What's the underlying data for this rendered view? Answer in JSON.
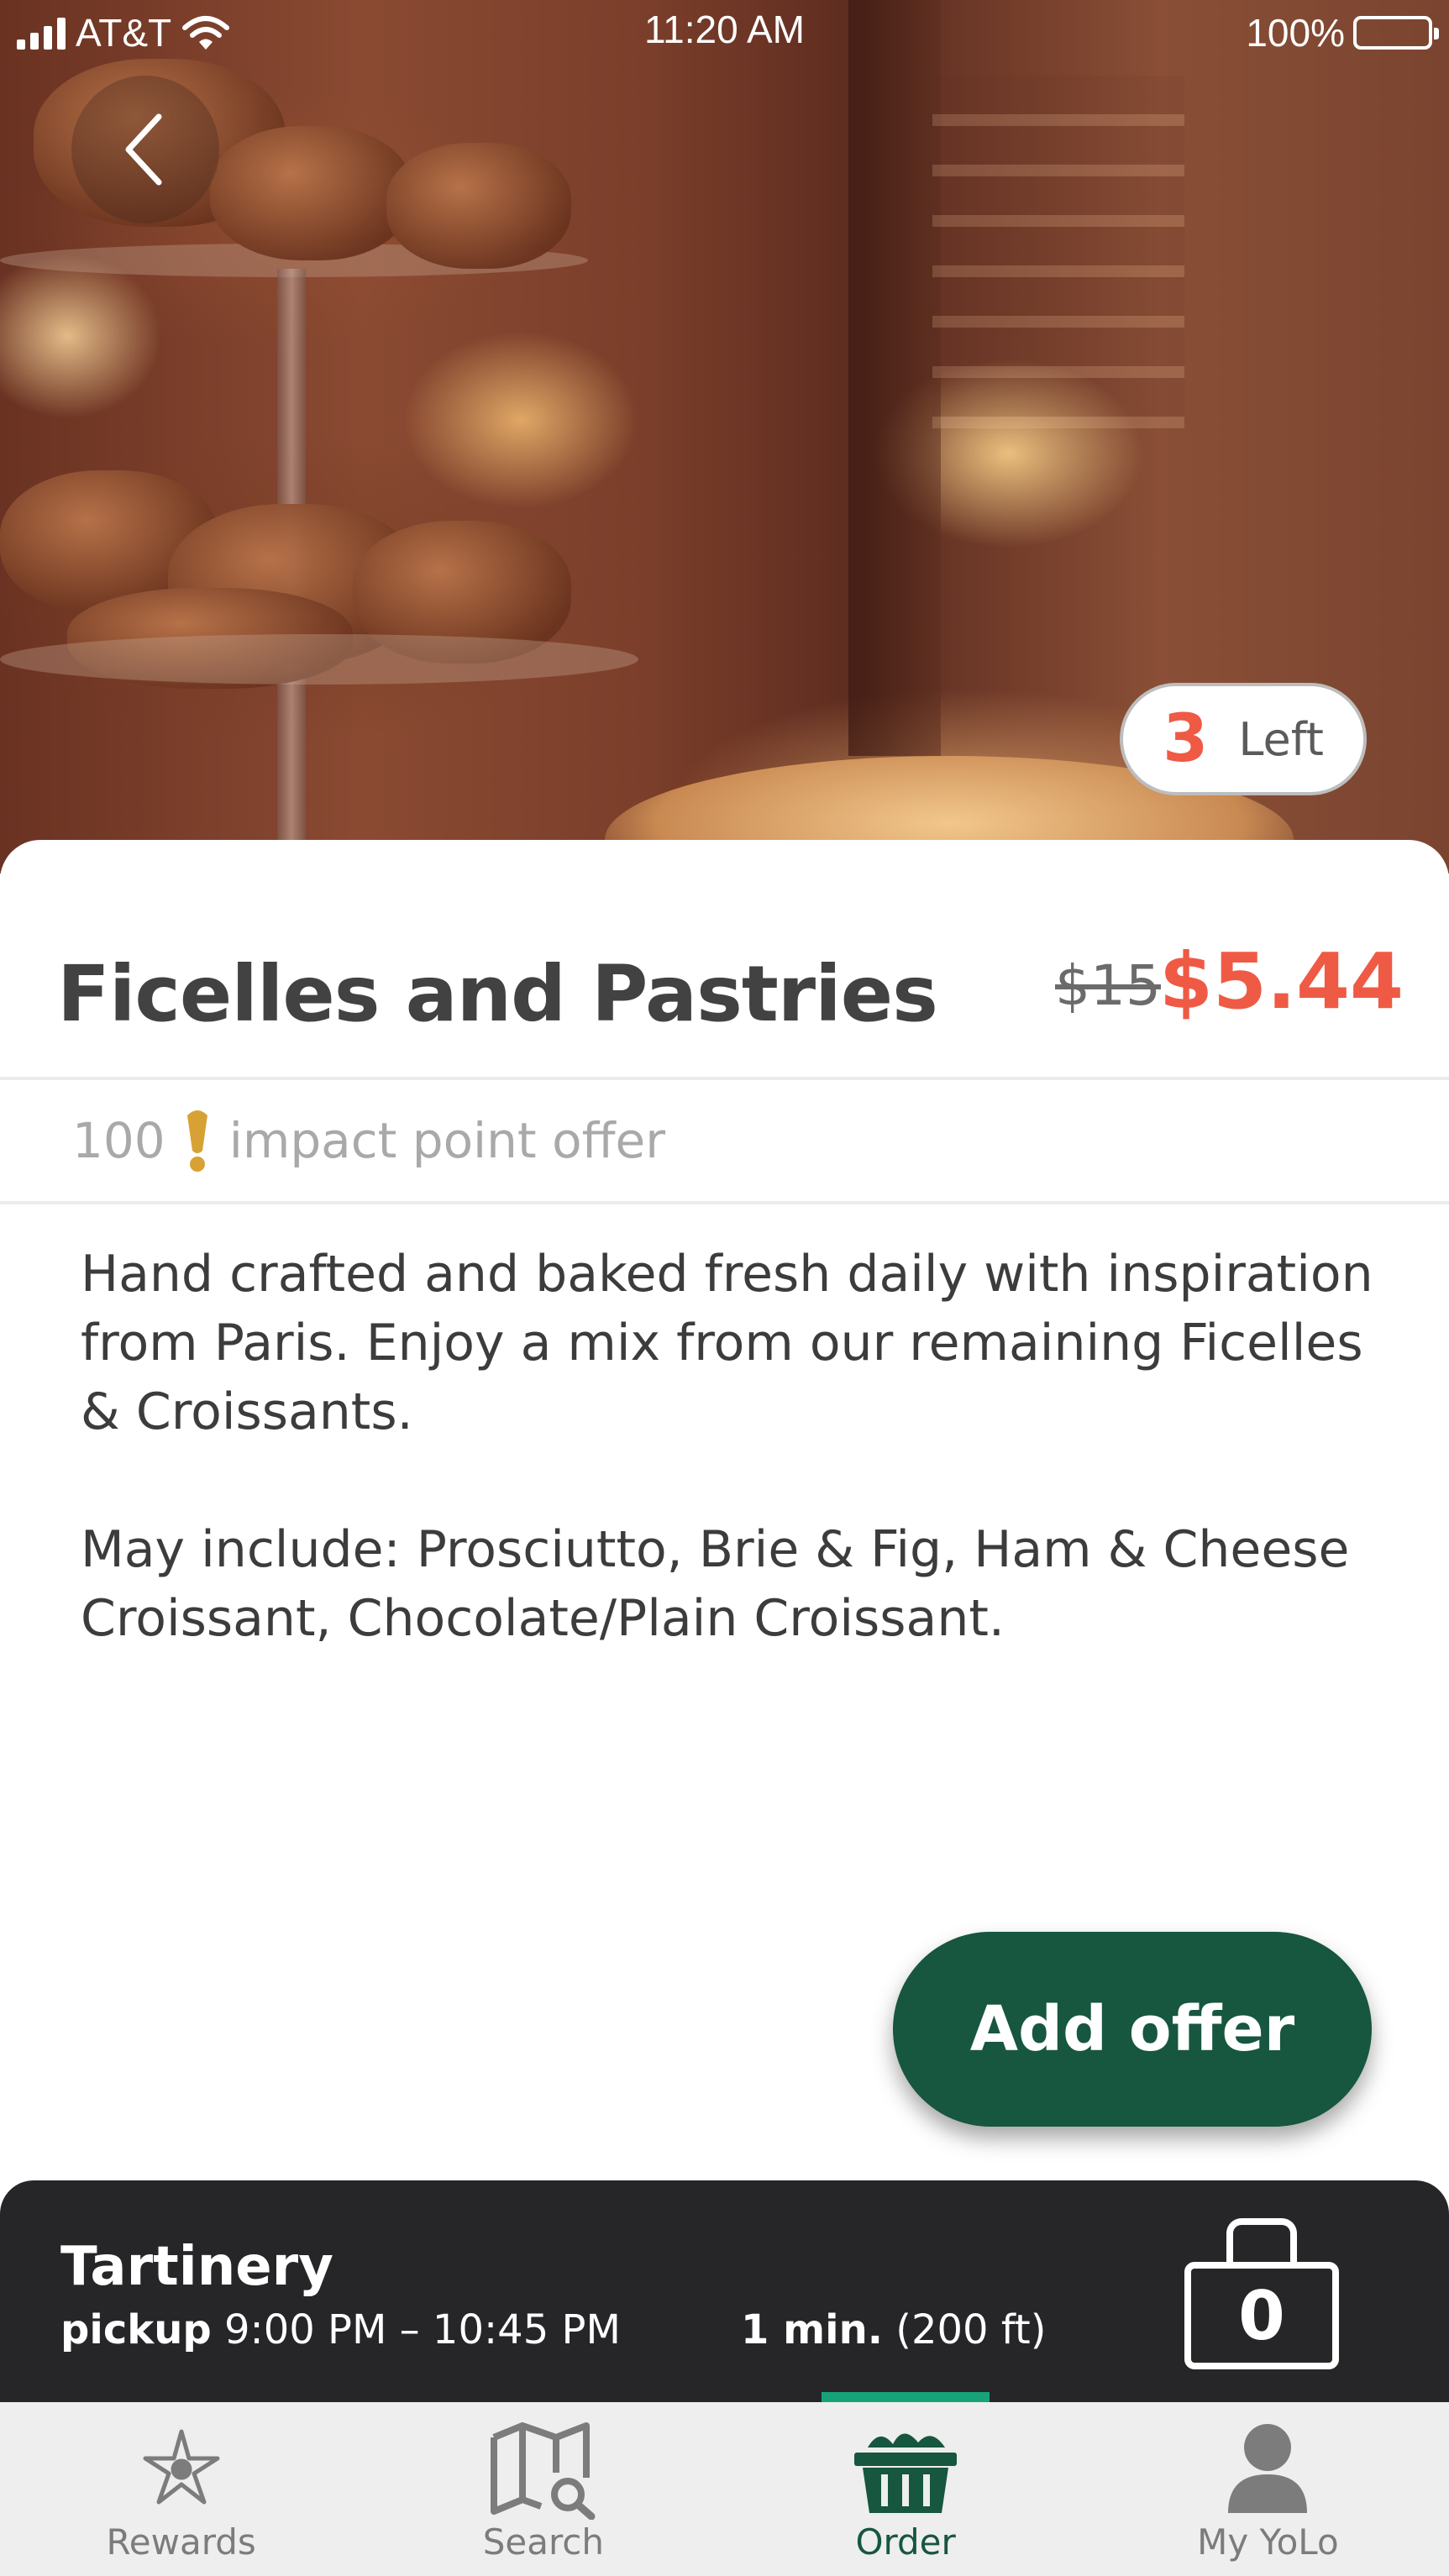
{
  "status_bar": {
    "carrier": "AT&T",
    "time": "11:20 AM",
    "battery": "100%"
  },
  "offer": {
    "remaining_count": "3",
    "remaining_label": "Left",
    "title": "Ficelles and Pastries",
    "original_price": "$15",
    "price": "$5.44",
    "impact_points": "100",
    "impact_label": "impact point offer",
    "description": [
      "Hand crafted and baked fresh daily with inspiration from Paris. Enjoy a mix from our remaining Ficelles & Croissants.",
      "May include: Prosciutto, Brie & Fig, Ham & Cheese Croissant, Chocolate/Plain Croissant."
    ],
    "add_button": "Add offer"
  },
  "pickup": {
    "store": "Tartinery",
    "pickup_label": "pickup",
    "window": "9:00 PM – 10:45 PM",
    "travel_time": "1 min.",
    "distance": "(200 ft)",
    "bag_count": "0"
  },
  "tabs": [
    {
      "label": "Rewards",
      "icon": "rewards-star-icon",
      "active": false
    },
    {
      "label": "Search",
      "icon": "map-search-icon",
      "active": false
    },
    {
      "label": "Order",
      "icon": "basket-icon",
      "active": true
    },
    {
      "label": "My YoLo",
      "icon": "user-icon",
      "active": false
    }
  ],
  "colors": {
    "accent_green": "#17563f",
    "price_red": "#ef5a45",
    "impact_gold": "#d7a233",
    "bar_dark": "#262629"
  }
}
